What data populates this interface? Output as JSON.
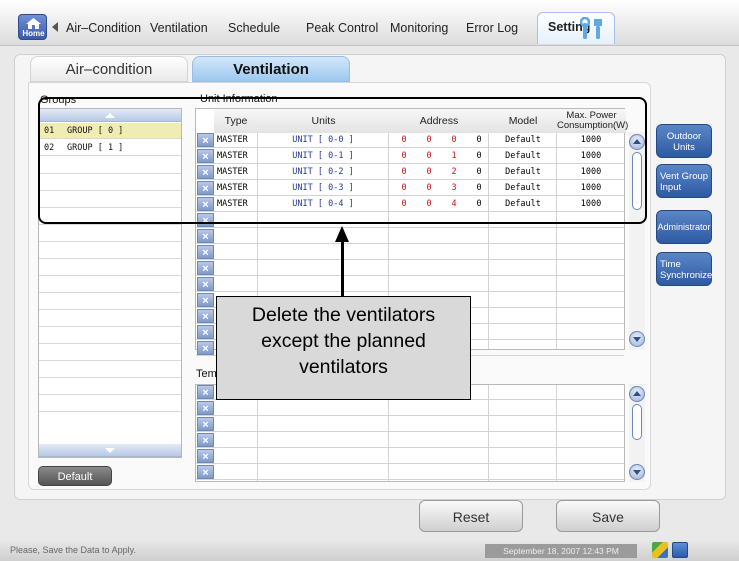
{
  "nav": {
    "home_label": "Home",
    "tabs": [
      "Air–Condition",
      "Ventilation",
      "Schedule",
      "Peak Control",
      "Monitoring",
      "Error Log",
      "Setting"
    ],
    "active_tab": "Setting"
  },
  "subtabs": {
    "air_condition": "Air–condition",
    "ventilation": "Ventilation"
  },
  "groups": {
    "title": "Groups",
    "items": [
      {
        "num": "01",
        "name": "GROUP [ 0 ]"
      },
      {
        "num": "02",
        "name": "GROUP [ 1 ]"
      }
    ],
    "default_button": "Default"
  },
  "unit_info": {
    "title": "Unit Information",
    "columns": [
      "Type",
      "Units",
      "Address",
      "Model",
      "Max. Power",
      "Consumption(W)"
    ],
    "rows": [
      {
        "type": "MASTER",
        "unit": "UNIT [ 0-0 ]",
        "addr": [
          "0",
          "0",
          "0",
          "0"
        ],
        "model": "Default",
        "power": "1000"
      },
      {
        "type": "MASTER",
        "unit": "UNIT [ 0-1 ]",
        "addr": [
          "0",
          "0",
          "1",
          "0"
        ],
        "model": "Default",
        "power": "1000"
      },
      {
        "type": "MASTER",
        "unit": "UNIT [ 0-2 ]",
        "addr": [
          "0",
          "0",
          "2",
          "0"
        ],
        "model": "Default",
        "power": "1000"
      },
      {
        "type": "MASTER",
        "unit": "UNIT [ 0-3 ]",
        "addr": [
          "0",
          "0",
          "3",
          "0"
        ],
        "model": "Default",
        "power": "1000"
      },
      {
        "type": "MASTER",
        "unit": "UNIT [ 0-4 ]",
        "addr": [
          "0",
          "0",
          "4",
          "0"
        ],
        "model": "Default",
        "power": "1000"
      }
    ],
    "delete_glyph": "×"
  },
  "temp_section_title": "Tem",
  "callout_lines": [
    "Delete the ventilators",
    "except the planned",
    "ventilators"
  ],
  "side_buttons": [
    {
      "l1": "Outdoor",
      "l2": "Units"
    },
    {
      "l1": "Vent Group",
      "l2": "Input"
    },
    {
      "l1": "Administrator",
      "l2": ""
    },
    {
      "l1": "Time",
      "l2": "Synchronize"
    }
  ],
  "actions": {
    "reset": "Reset",
    "save": "Save"
  },
  "status": {
    "message": "Please, Save the Data to Apply.",
    "datetime": "September 18, 2007 12:43 PM"
  },
  "colors": {
    "accent": "#2e5aa2",
    "address": "#d01010",
    "unit": "#223a9a",
    "selected_group": "#f0edb3"
  }
}
